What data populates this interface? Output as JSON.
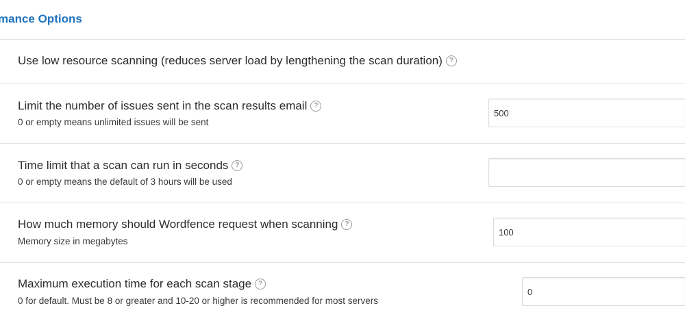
{
  "section": {
    "title": "mance Options"
  },
  "rows": [
    {
      "title": "Use low resource scanning (reduces server load by lengthening the scan duration)",
      "help_glyph": "?"
    },
    {
      "title": "Limit the number of issues sent in the scan results email",
      "subtitle": "0 or empty means unlimited issues will be sent",
      "help_glyph": "?",
      "value": "500"
    },
    {
      "title": "Time limit that a scan can run in seconds",
      "subtitle": "0 or empty means the default of 3 hours will be used",
      "help_glyph": "?",
      "value": ""
    },
    {
      "title": "How much memory should Wordfence request when scanning",
      "subtitle": "Memory size in megabytes",
      "help_glyph": "?",
      "value": "100"
    },
    {
      "title": "Maximum execution time for each scan stage",
      "subtitle": "0 for default. Must be 8 or greater and 10-20 or higher is recommended for most servers",
      "help_glyph": "?",
      "value": "0"
    }
  ],
  "icons": {
    "help": "help-circle-icon"
  },
  "colors": {
    "title_accent": "#1e73be",
    "divider": "#e2e2e2"
  }
}
